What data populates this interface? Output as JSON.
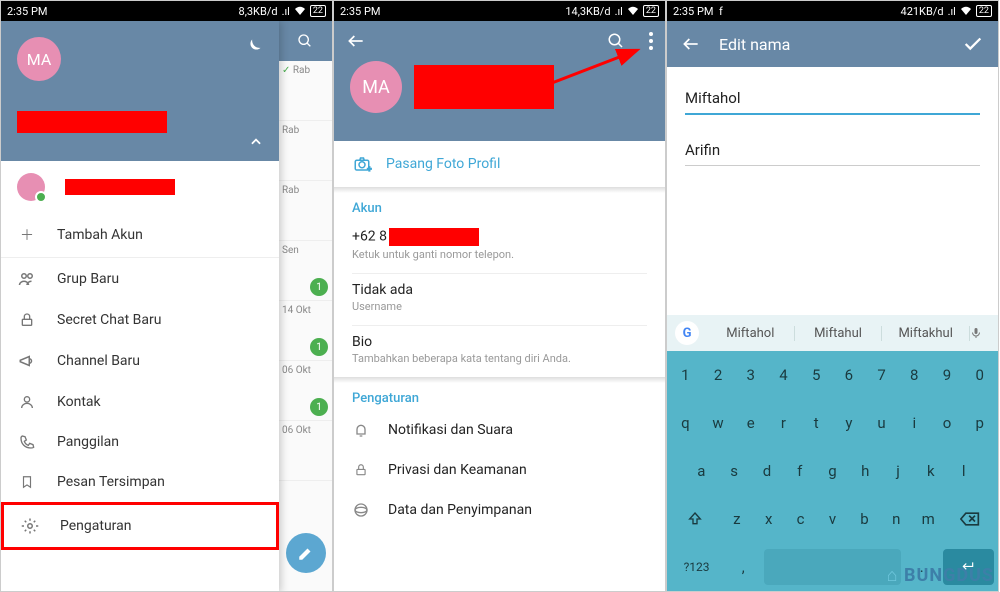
{
  "status": {
    "time": "2:35 PM",
    "net1": "8,3KB/d",
    "net2": "14,3KB/d",
    "net3": "421KB/d",
    "battery": "22"
  },
  "panel1": {
    "avatar_label": "MA",
    "account_label": "Tambah Akun",
    "menu": {
      "group": "Grup Baru",
      "secret": "Secret Chat Baru",
      "channel": "Channel Baru",
      "contacts": "Kontak",
      "calls": "Panggilan",
      "saved": "Pesan Tersimpan",
      "settings": "Pengaturan"
    },
    "chat_dates": [
      "Rab",
      "Rab",
      "Rab",
      "Sen",
      "14 Okt",
      "06 Okt",
      "06 Okt"
    ]
  },
  "panel2": {
    "avatar_label": "MA",
    "photo_link": "Pasang Foto Profil",
    "section_account": "Akun",
    "phone_prefix": "+62 8",
    "phone_sub": "Ketuk untuk ganti nomor telepon.",
    "username_main": "Tidak ada",
    "username_sub": "Username",
    "bio_main": "Bio",
    "bio_sub": "Tambahkan beberapa kata tentang diri Anda.",
    "section_settings": "Pengaturan",
    "settings": {
      "notif": "Notifikasi dan Suara",
      "privacy": "Privasi dan Keamanan",
      "data": "Data dan Penyimpanan"
    }
  },
  "panel3": {
    "title": "Edit nama",
    "first": "Miftahol",
    "last": "Arifin",
    "suggestions": [
      "Miftahol",
      "Miftahul",
      "Miftakhul"
    ],
    "kb_row1": [
      "1",
      "2",
      "3",
      "4",
      "5",
      "6",
      "7",
      "8",
      "9",
      "0"
    ],
    "kb_row2": [
      "q",
      "w",
      "e",
      "r",
      "t",
      "y",
      "u",
      "i",
      "o",
      "p"
    ],
    "kb_row3": [
      "a",
      "s",
      "d",
      "f",
      "g",
      "h",
      "j",
      "k",
      "l"
    ],
    "kb_row4": [
      "z",
      "x",
      "c",
      "v",
      "b",
      "n",
      "m"
    ],
    "kb_sym": "?123"
  },
  "watermark": "BUNGDUS"
}
